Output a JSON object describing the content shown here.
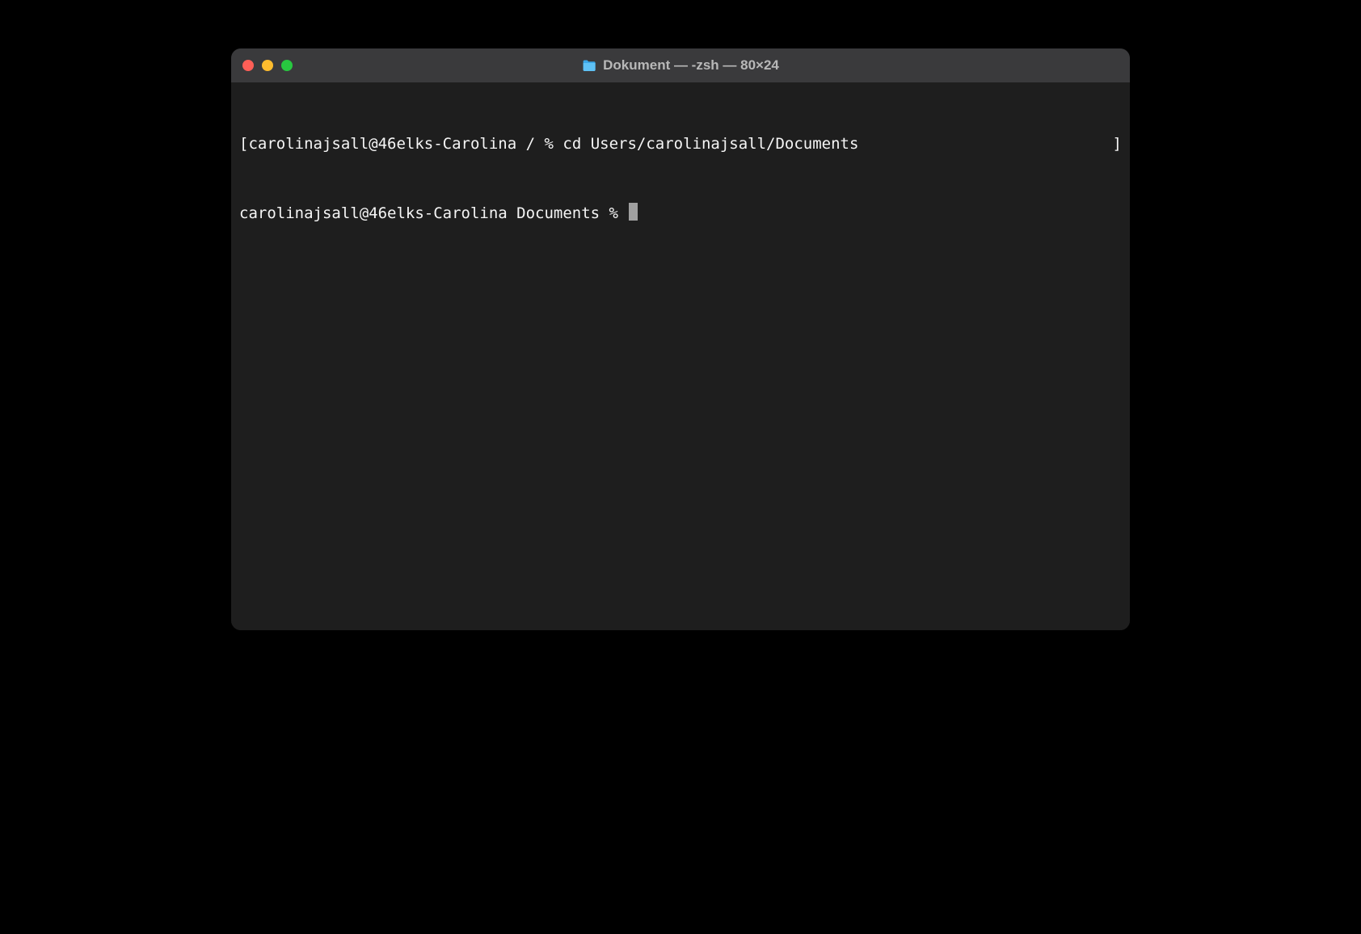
{
  "window": {
    "title": "Dokument — -zsh — 80×24"
  },
  "terminal": {
    "line1_left_bracket": "[",
    "line1_prompt": "carolinajsall@46elks-Carolina / % ",
    "line1_command": "cd Users/carolinajsall/Documents",
    "line1_right_bracket": "]",
    "line2_prompt": "carolinajsall@46elks-Carolina Documents % "
  }
}
